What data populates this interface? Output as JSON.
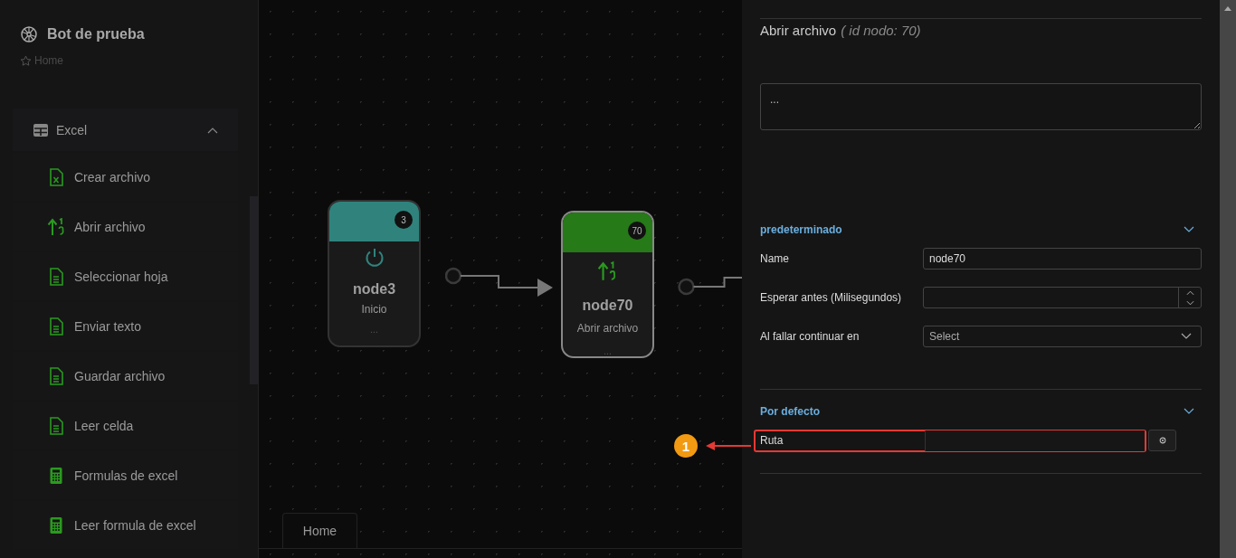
{
  "sidebar": {
    "title": "Bot de prueba",
    "breadcrumb": "Home",
    "group": {
      "label": "Excel",
      "expanded": true,
      "items": [
        {
          "label": "Crear archivo",
          "kind": "excel"
        },
        {
          "label": "Abrir archivo",
          "kind": "sort"
        },
        {
          "label": "Seleccionar hoja",
          "kind": "doc"
        },
        {
          "label": "Enviar texto",
          "kind": "doc"
        },
        {
          "label": "Guardar archivo",
          "kind": "doc"
        },
        {
          "label": "Leer celda",
          "kind": "doc"
        },
        {
          "label": "Formulas de excel",
          "kind": "calc"
        },
        {
          "label": "Leer formula de excel",
          "kind": "calc"
        }
      ]
    }
  },
  "canvas": {
    "nodes": [
      {
        "badge": "3",
        "name": "node3",
        "type": "Inicio",
        "footer": "...",
        "kind": "power",
        "color": "#30837d",
        "selected": false
      },
      {
        "badge": "70",
        "name": "node70",
        "type": "Abrir archivo",
        "footer": "...",
        "kind": "sort",
        "color": "#267a17",
        "selected": true
      }
    ],
    "tabs": [
      {
        "label": "Home",
        "selected": true
      }
    ]
  },
  "panel": {
    "title": "Abrir archivo",
    "subtitle": "( id nodo: 70)",
    "description": "...",
    "sections": [
      {
        "title": "predeterminado",
        "expanded": true,
        "fields": [
          {
            "label": "Name",
            "kind": "text",
            "value": "node70"
          },
          {
            "label": "Esperar antes (Milisegundos)",
            "kind": "number"
          },
          {
            "label": "Al fallar continuar en",
            "kind": "select",
            "placeholder": "Select"
          }
        ]
      },
      {
        "title": "Por defecto",
        "expanded": true,
        "fields": [
          {
            "label": "Ruta",
            "kind": "file",
            "highlighted": true
          }
        ]
      }
    ]
  },
  "annotation": {
    "label": "1"
  }
}
